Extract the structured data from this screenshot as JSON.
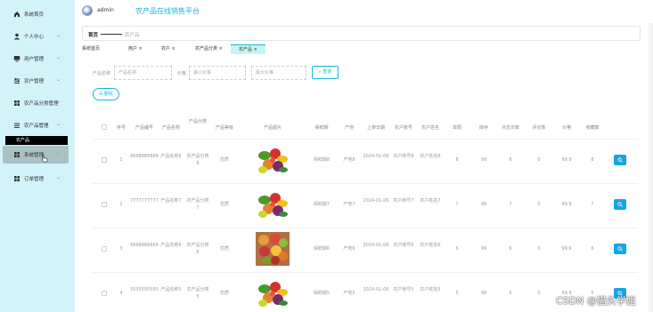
{
  "header": {
    "admin_name": "admin",
    "site_title": "农产品在线销售平台"
  },
  "sidebar": {
    "items": [
      {
        "label": "系统首页",
        "icon": "home-icon",
        "has_chevron": false
      },
      {
        "label": "个人中心",
        "icon": "user-icon",
        "has_chevron": true
      },
      {
        "label": "用户管理",
        "icon": "monitor-icon",
        "has_chevron": true
      },
      {
        "label": "农户管理",
        "icon": "sliders-icon",
        "has_chevron": true
      },
      {
        "label": "农产品分类管理",
        "icon": "grid-icon",
        "has_chevron": true
      },
      {
        "label": "农产品管理",
        "icon": "list-icon",
        "has_chevron": true
      },
      {
        "label": "系统管理",
        "icon": "grid-icon",
        "has_chevron": true
      },
      {
        "label": "订单管理",
        "icon": "grid-icon",
        "has_chevron": true
      }
    ],
    "sub_item_label": "农产品"
  },
  "breadcrumb": {
    "home": "首页",
    "current": "农产品"
  },
  "tabs": [
    {
      "label": "系统首页",
      "closable": false
    },
    {
      "label": "用户",
      "closable": true
    },
    {
      "label": "农户",
      "closable": true
    },
    {
      "label": "农产品分类",
      "closable": true
    },
    {
      "label": "农产品",
      "closable": true,
      "active": true
    }
  ],
  "search": {
    "name_label": "产品名称",
    "name_placeholder": "产品名称",
    "price_label": "价格",
    "min_placeholder": "最小价格",
    "max_placeholder": "最大价格",
    "search_button": "查询",
    "delete_button": "删除"
  },
  "table": {
    "columns": [
      "序号",
      "产品编号",
      "产品名称",
      "产品分类",
      "产品等级",
      "产品图片",
      "保鲜期",
      "产地",
      "上架日期",
      "农户账号",
      "农户姓名",
      "单限",
      "库存",
      "点击次数",
      "评论数",
      "价格",
      "收藏数"
    ],
    "rows": [
      {
        "index": "1",
        "code": "8888888888",
        "name": "产品名称8",
        "category": "农产品分类8",
        "grade": "优质",
        "shelf": "保鲜期8",
        "origin": "产地8",
        "date": "2024-01-06",
        "account": "农户账号8",
        "farmer": "农户姓名8",
        "limit": "8",
        "stock": "99",
        "clicks": "8",
        "comments": "0",
        "price": "99.9",
        "favorites": "8"
      },
      {
        "index": "2",
        "code": "7777777777",
        "name": "产品名称7",
        "category": "农产品分类7",
        "grade": "优质",
        "shelf": "保鲜期7",
        "origin": "产地7",
        "date": "2024-01-06",
        "account": "农户账号7",
        "farmer": "农户姓名7",
        "limit": "7",
        "stock": "99",
        "clicks": "7",
        "comments": "0",
        "price": "99.9",
        "favorites": "7"
      },
      {
        "index": "3",
        "code": "6666666666",
        "name": "产品名称6",
        "category": "农产品分类6",
        "grade": "优质",
        "shelf": "保鲜期6",
        "origin": "产地6",
        "date": "2024-01-06",
        "account": "农户账号6",
        "farmer": "农户姓名6",
        "limit": "6",
        "stock": "99",
        "clicks": "6",
        "comments": "0",
        "price": "99.9",
        "favorites": "6"
      },
      {
        "index": "4",
        "code": "5555555555",
        "name": "产品名称5",
        "category": "农产品分类5",
        "grade": "优质",
        "shelf": "保鲜期5",
        "origin": "产地5",
        "date": "2024-01-06",
        "account": "农户账号5",
        "farmer": "农户姓名5",
        "limit": "5",
        "stock": "99",
        "clicks": "5",
        "comments": "0",
        "price": "99.9",
        "favorites": "5"
      }
    ]
  },
  "watermark": "CSDN @猫头学姐",
  "colors": {
    "accent": "#16b8d3",
    "sidebar_bg": "#d2f3f7",
    "action_blue": "#14a6e3"
  }
}
